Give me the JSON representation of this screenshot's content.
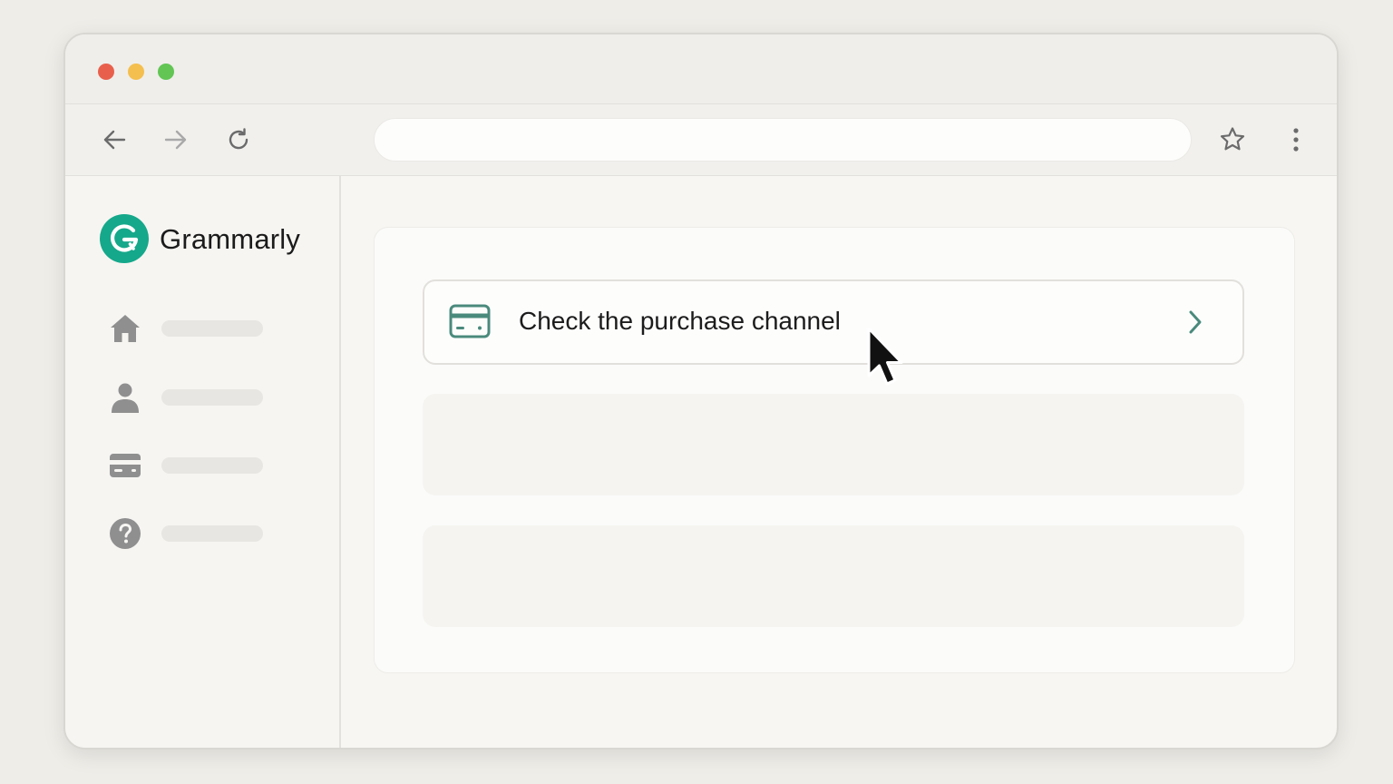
{
  "window": {
    "traffic_lights": [
      {
        "name": "close",
        "color": "#e8604c"
      },
      {
        "name": "minimize",
        "color": "#f4bf4f"
      },
      {
        "name": "maximize",
        "color": "#62c554"
      }
    ]
  },
  "toolbar": {
    "back_icon": "arrow-left-icon",
    "forward_icon": "arrow-right-icon",
    "reload_icon": "reload-icon",
    "address_value": "",
    "bookmark_icon": "star-icon",
    "menu_icon": "kebab-menu-icon"
  },
  "sidebar": {
    "brand": {
      "name": "Grammarly",
      "logo_icon": "grammarly-logo-icon",
      "logo_color": "#15a88a"
    },
    "items": [
      {
        "icon": "home-icon"
      },
      {
        "icon": "user-icon"
      },
      {
        "icon": "credit-card-icon"
      },
      {
        "icon": "help-icon"
      }
    ]
  },
  "main": {
    "action": {
      "label": "Check the purchase channel",
      "icon": "credit-card-icon",
      "icon_color": "#4a8a7c",
      "chevron_icon": "chevron-right-icon"
    }
  },
  "cursor": {
    "icon": "mouse-pointer-icon"
  }
}
